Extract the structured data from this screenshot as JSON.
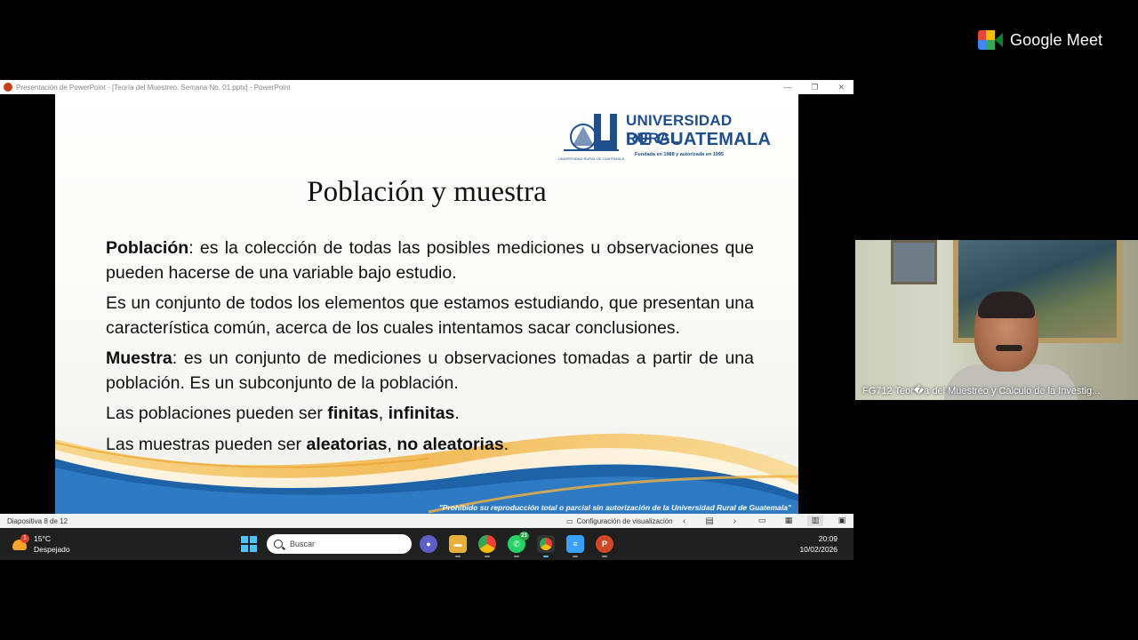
{
  "meet": {
    "brand": "Google Meet"
  },
  "window": {
    "title": "Presentación de PowerPoint - [Teoría del Muestreo. Semana No. 01.pptx] - PowerPoint"
  },
  "slide": {
    "logo": {
      "line1": "UNIVERSIDAD RURAL",
      "line2": "DE GUATEMALA",
      "tagline": "Fundada en 1988 y autorizada en 1995",
      "crest_text": "UNIVERSIDAD RURAL DE GUATEMALA"
    },
    "title": "Población y muestra",
    "p1_term": "Población",
    "p1_text": ": es la colección de todas las posibles mediciones u observaciones que pueden hacerse de una variable bajo estudio.",
    "p2_text": "Es un conjunto de todos los elementos que estamos estudiando, que presentan una característica común, acerca de los cuales intentamos sacar conclusiones.",
    "p3_term": "Muestra",
    "p3_text": ": es un conjunto de mediciones u observaciones tomadas a partir de una población. Es un subconjunto de la población.",
    "p4_prefix": "Las poblaciones pueden ser ",
    "p4_a": "finitas",
    "p4_sep": ", ",
    "p4_b": "infinitas",
    "p4_end": ".",
    "p5_prefix": "Las muestras pueden ser ",
    "p5_a": "aleatorias",
    "p5_sep": ", ",
    "p5_b": "no aleatorias",
    "p5_end": ".",
    "footer": "\"Prohibido su reproducción total o parcial sin autorización de la Universidad Rural de Guatemala\""
  },
  "statusbar": {
    "slide_count": "Diapositiva 8 de 12",
    "display_settings": "Configuración de visualización"
  },
  "taskbar": {
    "temp": "15°C",
    "weather": "Despejado",
    "weather_badge": "1",
    "search_placeholder": "Buscar",
    "whatsapp_badge": "23",
    "time": "20:09",
    "date": "10/02/2026"
  },
  "participant": {
    "name": "FG712 Teor�a del Muestreo y Calculo de la Investig..."
  }
}
